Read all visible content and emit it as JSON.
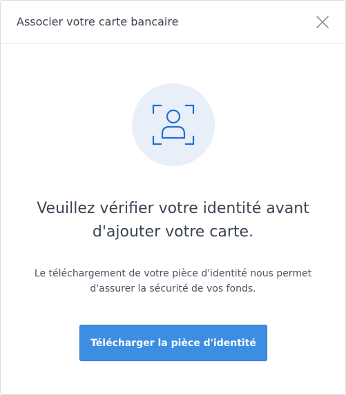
{
  "modal": {
    "title": "Associer votre carte bancaire",
    "close_icon": "close-icon"
  },
  "illustration": {
    "icon": "identity-scan-icon",
    "circle_color": "#e8eff9",
    "icon_color": "#1f6fce"
  },
  "content": {
    "heading": "Veuillez vérifier votre identité avant d'ajouter votre carte.",
    "description": "Le téléchargement de votre pièce d'identité nous permet d'assurer la sécurité de vos fonds."
  },
  "actions": {
    "upload_label": "Télécharger la pièce d'identité",
    "accent_color": "#3d8ee3"
  }
}
